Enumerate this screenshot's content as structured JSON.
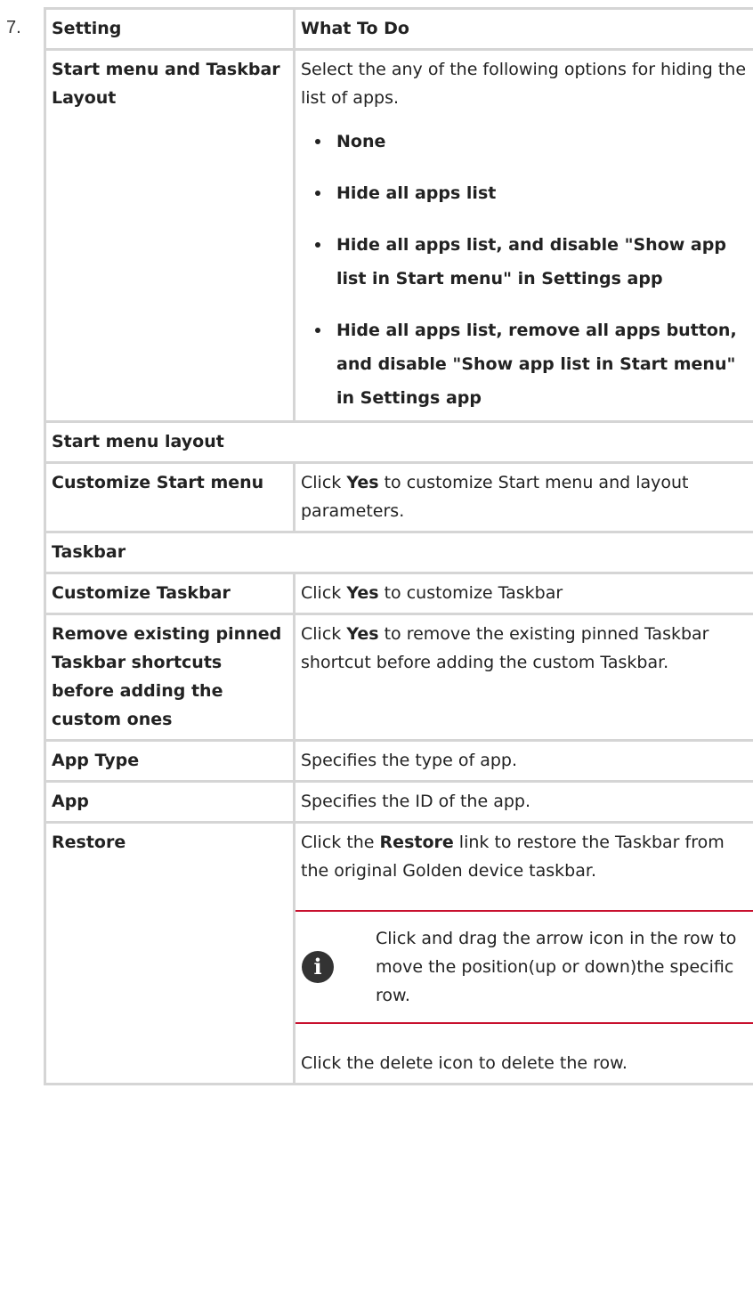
{
  "step_number": "7.",
  "table": {
    "header": {
      "setting": "Setting",
      "what_to_do": "What To Do"
    },
    "start_layout": {
      "setting": "Start menu and Taskbar Layout",
      "intro": "Select the any of the following options for hiding the list of apps.",
      "options": [
        "None",
        "Hide all apps list",
        "Hide all apps list, and disable \"Show app list in Start menu\" in Settings app",
        "Hide all apps list, remove all apps button, and disable \"Show app list in Start menu\" in Settings app"
      ]
    },
    "section_start_menu": "Start menu layout",
    "customize_start": {
      "setting": "Customize Start menu",
      "pre": "Click ",
      "bold": "Yes",
      "post": " to customize Start menu and layout parameters."
    },
    "section_taskbar": "Taskbar",
    "customize_taskbar": {
      "setting": "Customize Taskbar",
      "pre": "Click ",
      "bold": "Yes",
      "post": " to customize Taskbar"
    },
    "remove_pinned": {
      "setting": "Remove existing pinned Taskbar shortcuts before adding the custom ones",
      "pre": "Click ",
      "bold": "Yes",
      "post": " to remove the existing pinned Taskbar shortcut before adding the custom Taskbar."
    },
    "app_type": {
      "setting": "App Type",
      "desc": "Specifies the type of app."
    },
    "app": {
      "setting": "App",
      "desc": "Specifies the ID of the app."
    },
    "restore": {
      "setting": "Restore",
      "pre": "Click the ",
      "bold": "Restore",
      "post": " link to restore the Taskbar from the original Golden device taskbar.",
      "note_icon": "info-icon",
      "note": "Click and drag the arrow icon in the row to move the position(up or down)the specific row.",
      "after": "Click the delete icon to delete the row."
    }
  },
  "colors": {
    "border": "#d5d5d5",
    "note_rule": "#c8102e",
    "icon_bg": "#333333"
  }
}
